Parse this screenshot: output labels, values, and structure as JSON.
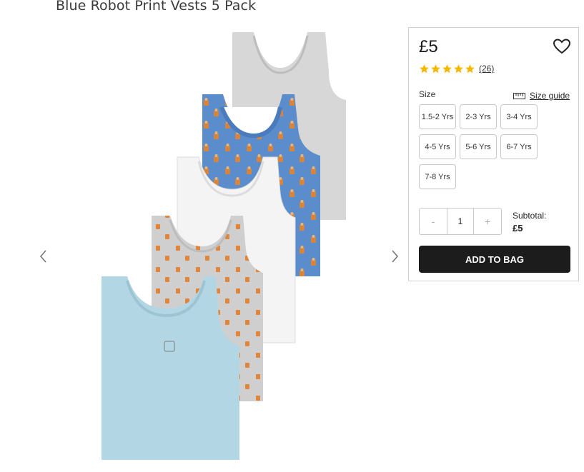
{
  "product": {
    "title": "Blue Robot Print Vests 5 Pack",
    "price": "£5",
    "rating": 5,
    "review_count": "(26)",
    "image_alt": "Five sleeveless vests: grey, blue robot print, white, grey print, light blue"
  },
  "sizes": {
    "label": "Size",
    "guide_label": "Size guide",
    "options": [
      "1.5-2 Yrs",
      "2-3 Yrs",
      "3-4 Yrs",
      "4-5 Yrs",
      "5-6 Yrs",
      "6-7 Yrs",
      "7-8 Yrs"
    ]
  },
  "quantity": {
    "decrement": "-",
    "value": "1",
    "increment": "+"
  },
  "subtotal": {
    "label": "Subtotal:",
    "amount": "£5"
  },
  "add_to_bag": "ADD TO BAG",
  "colors": {
    "star": "#f5b800",
    "button_bg": "#1c1c1c",
    "border": "#c9c9c9"
  }
}
